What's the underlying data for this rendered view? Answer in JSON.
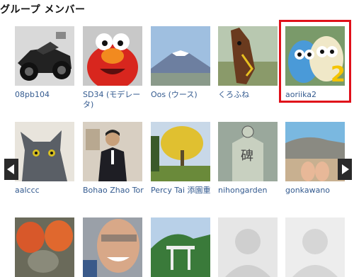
{
  "header": {
    "title": "グループ メンバー"
  },
  "members": [
    {
      "name": "08pb104"
    },
    {
      "name": "SD34 (モデレータ)"
    },
    {
      "name": "Oos (ウース)"
    },
    {
      "name": "くろふね"
    },
    {
      "name": "aoriika2"
    },
    {
      "name": "aalccc"
    },
    {
      "name": "Bohao Zhao Tor"
    },
    {
      "name": "Percy Tai 添園重"
    },
    {
      "name": "nihongarden"
    },
    {
      "name": "gonkawano"
    },
    {
      "name": ""
    },
    {
      "name": ""
    },
    {
      "name": ""
    },
    {
      "name": ""
    },
    {
      "name": ""
    }
  ],
  "colors": {
    "link": "#335a8f",
    "selected_border": "#e0101a"
  },
  "icons": {
    "prev": "chevron-left-icon",
    "next": "chevron-right-icon"
  }
}
